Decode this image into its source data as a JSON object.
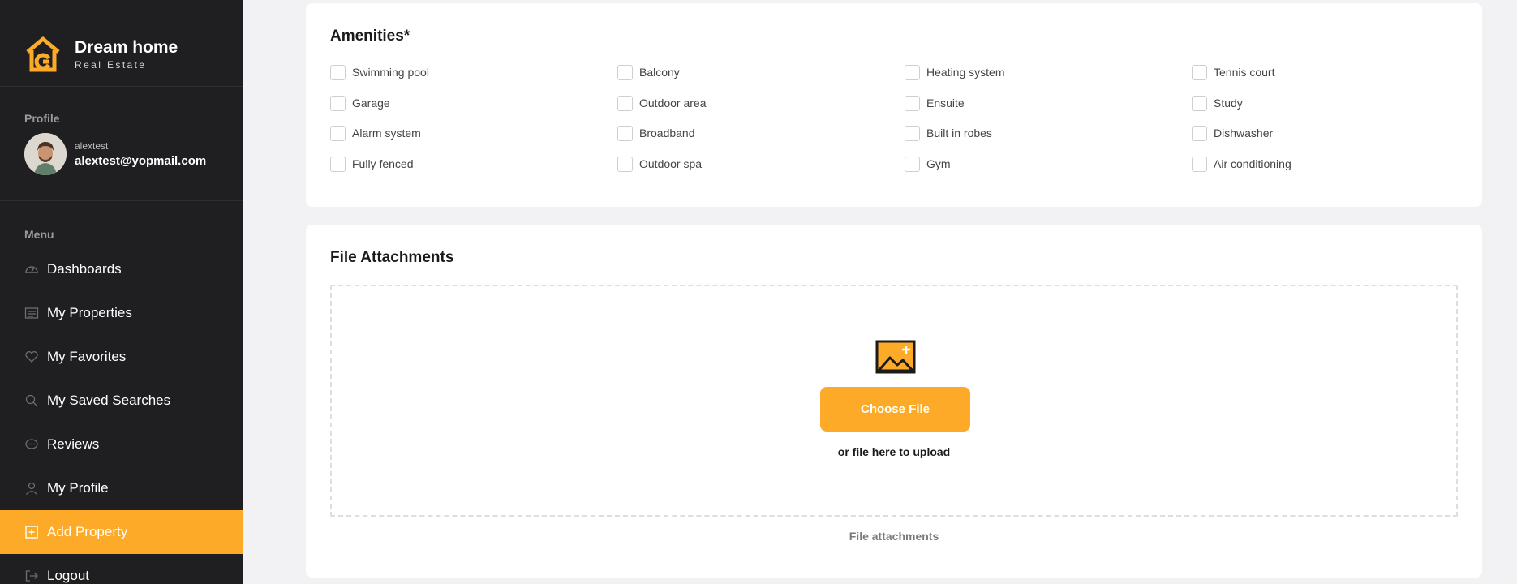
{
  "brand": {
    "name": "Dream home",
    "subtitle": "Real Estate",
    "accent": "#fdaa28"
  },
  "profile": {
    "label": "Profile",
    "username": "alextest",
    "email": "alextest@yopmail.com"
  },
  "menu": {
    "label": "Menu",
    "items": [
      {
        "label": "Dashboards",
        "icon": "gauge-icon"
      },
      {
        "label": "My Properties",
        "icon": "list-icon"
      },
      {
        "label": "My Favorites",
        "icon": "heart-icon"
      },
      {
        "label": "My Saved Searches",
        "icon": "search-icon"
      },
      {
        "label": "Reviews",
        "icon": "chat-icon"
      },
      {
        "label": "My Profile",
        "icon": "user-icon"
      },
      {
        "label": "Add Property",
        "icon": "plus-square-icon",
        "active": true
      },
      {
        "label": "Logout",
        "icon": "logout-icon"
      }
    ]
  },
  "amenities": {
    "title": "Amenities*",
    "items": [
      "Swimming pool",
      "Balcony",
      "Heating system",
      "Tennis court",
      "Garage",
      "Outdoor area",
      "Ensuite",
      "Study",
      "Alarm system",
      "Broadband",
      "Built in robes",
      "Dishwasher",
      "Fully fenced",
      "Outdoor spa",
      "Gym",
      "Air conditioning"
    ]
  },
  "attachments": {
    "title": "File Attachments",
    "button_label": "Choose File",
    "hint": "or file here to upload",
    "caption": "File attachments"
  }
}
